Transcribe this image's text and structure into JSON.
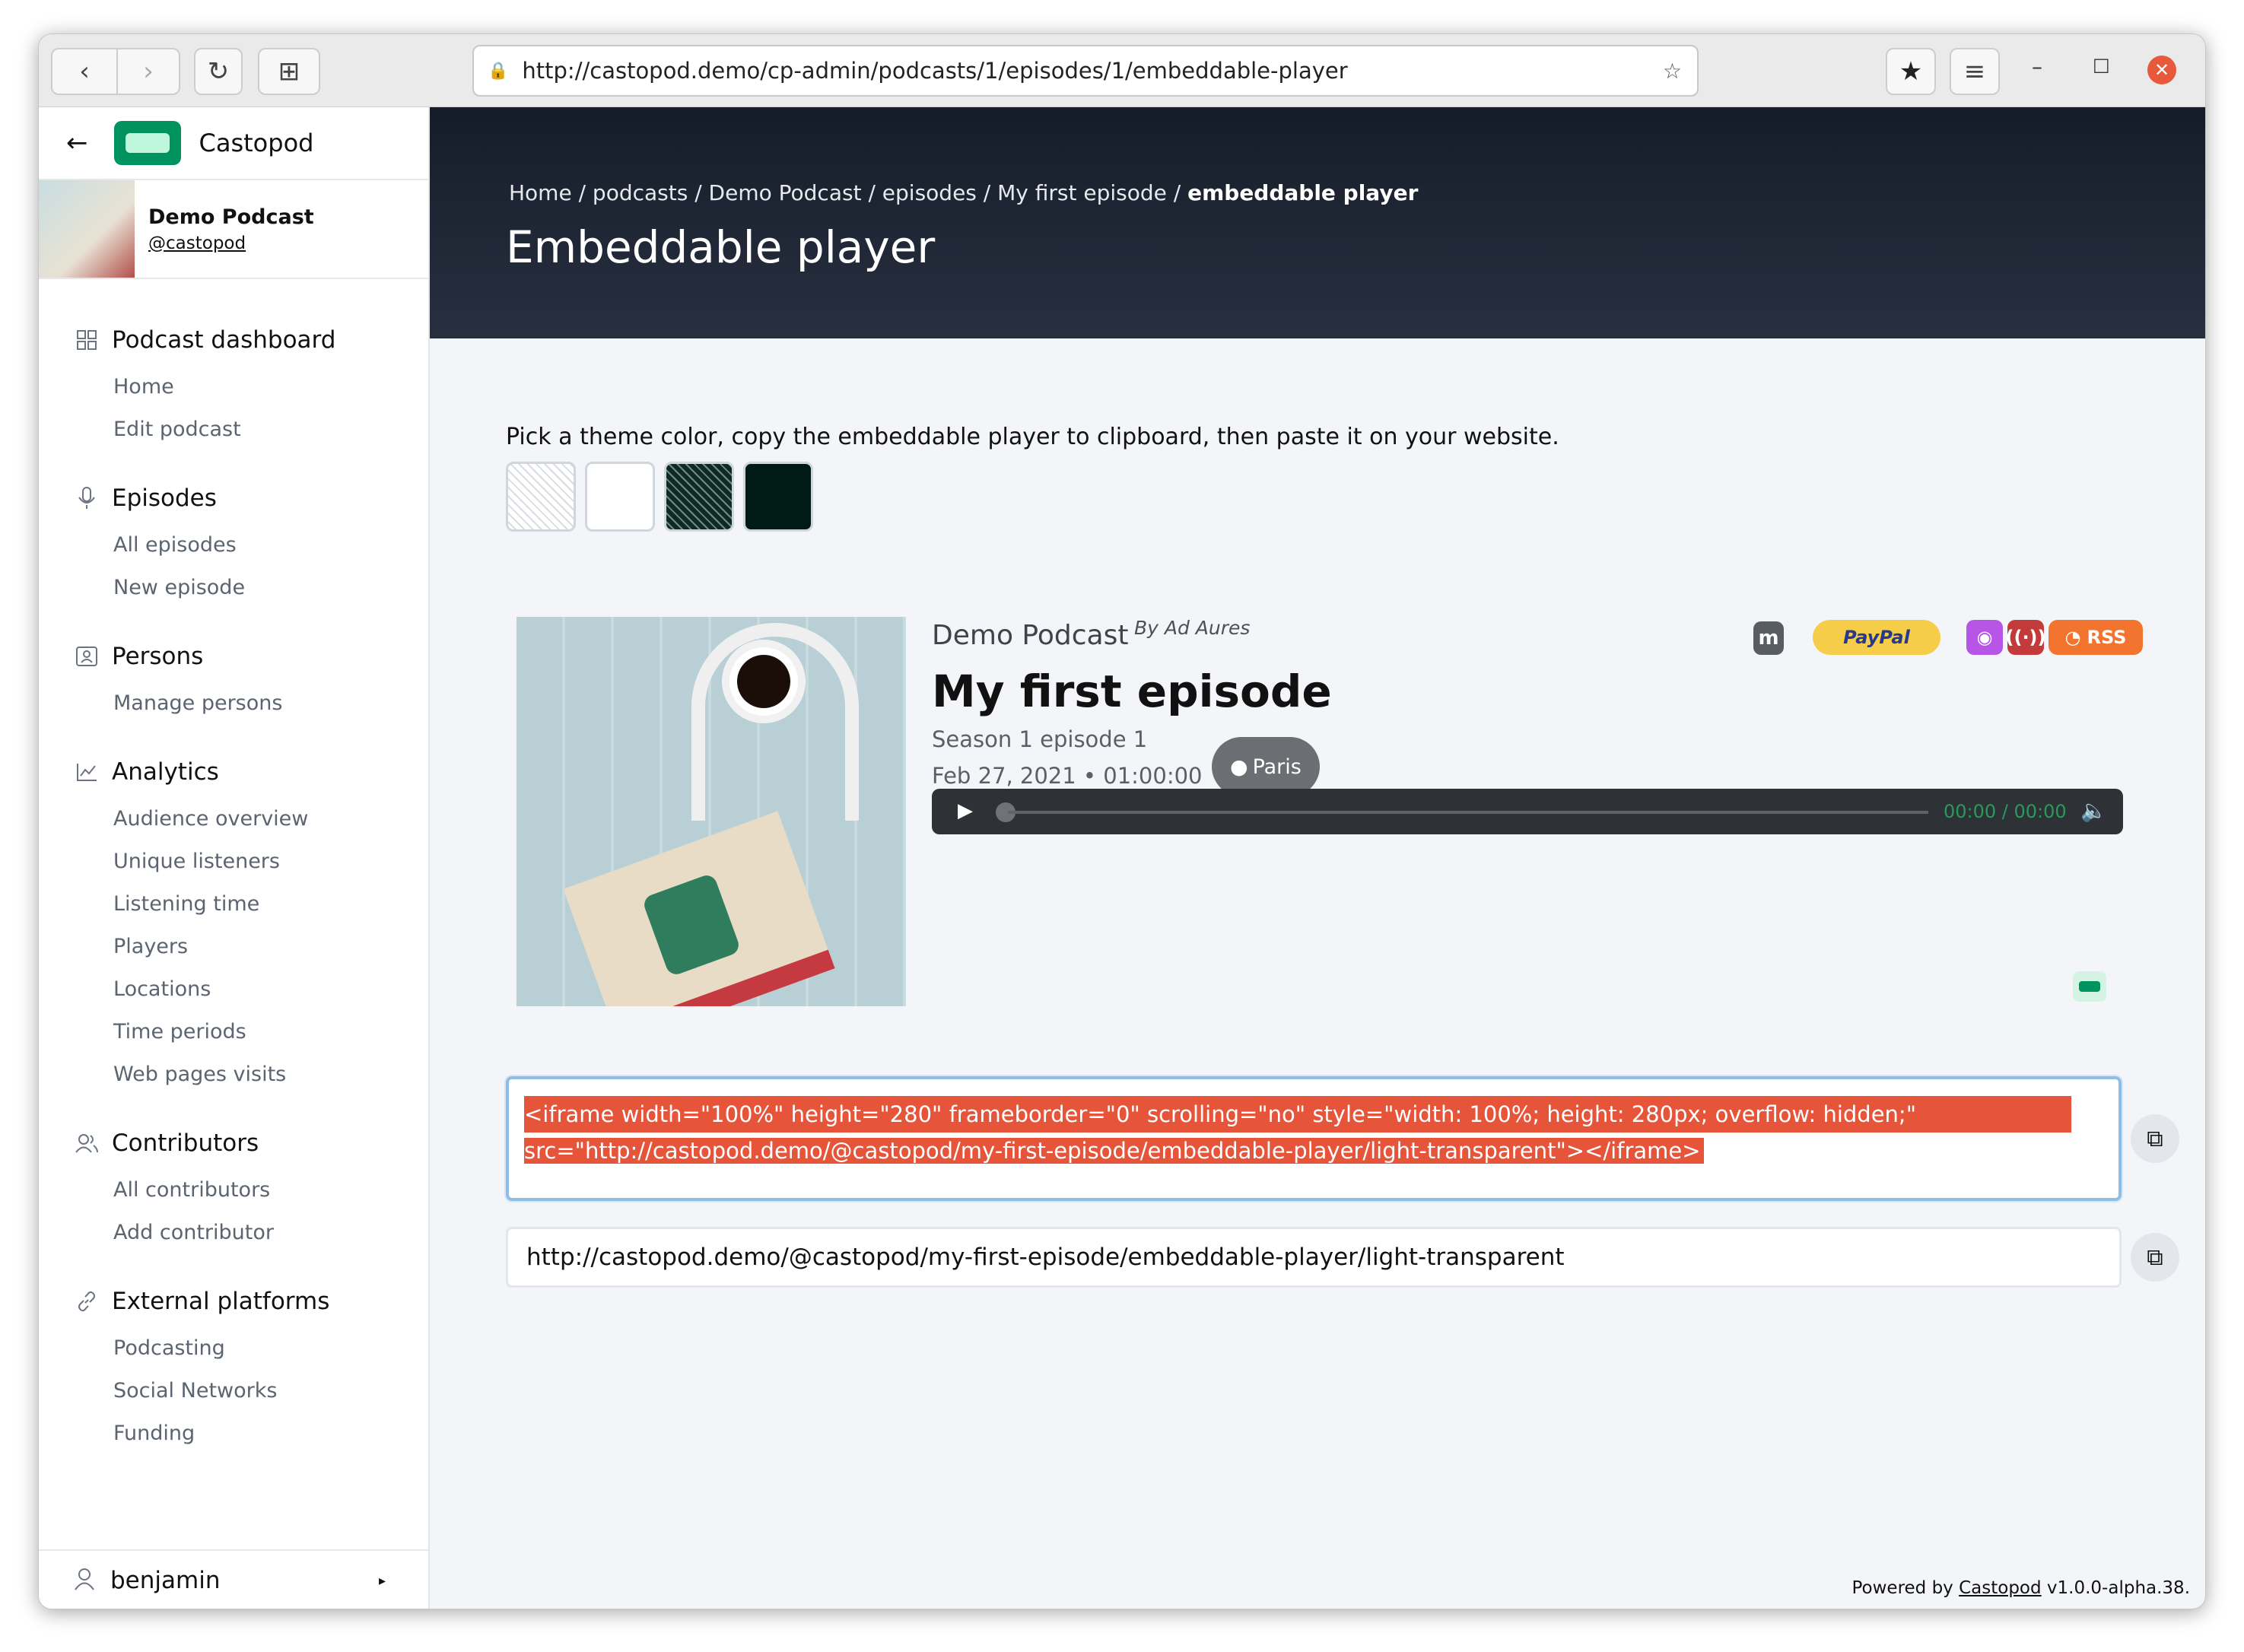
{
  "browser": {
    "url": "http://castopod.demo/cp-admin/podcasts/1/episodes/1/embeddable-player"
  },
  "sidebar": {
    "brand": "Castopod",
    "podcast_name": "Demo Podcast",
    "podcast_handle": "@castopod",
    "sections": [
      {
        "title": "Podcast dashboard",
        "items": [
          "Home",
          "Edit podcast"
        ]
      },
      {
        "title": "Episodes",
        "items": [
          "All episodes",
          "New episode"
        ]
      },
      {
        "title": "Persons",
        "items": [
          "Manage persons"
        ]
      },
      {
        "title": "Analytics",
        "items": [
          "Audience overview",
          "Unique listeners",
          "Listening time",
          "Players",
          "Locations",
          "Time periods",
          "Web pages visits"
        ]
      },
      {
        "title": "Contributors",
        "items": [
          "All contributors",
          "Add contributor"
        ]
      },
      {
        "title": "External platforms",
        "items": [
          "Podcasting",
          "Social Networks",
          "Funding"
        ]
      }
    ],
    "user": "benjamin"
  },
  "header": {
    "breadcrumb": [
      "Home",
      "podcasts",
      "Demo Podcast",
      "episodes",
      "My first episode"
    ],
    "breadcrumb_current": "embeddable player",
    "title": "Embeddable player"
  },
  "main": {
    "description": "Pick a theme color, copy the embeddable player to clipboard, then paste it on your website.",
    "theme_colors": [
      "#ffffff",
      "#ffffff",
      "#173b33",
      "#001a16"
    ],
    "preview": {
      "podcast": "Demo Podcast",
      "author": "By Ad Aures",
      "episode_title": "My first episode",
      "season_episode": "Season 1 episode 1",
      "date_duration": "Feb 27, 2021 • 01:00:00",
      "location": "Paris",
      "paypal": "PayPal",
      "rss": "RSS",
      "time": "00:00 / 00:00"
    },
    "iframe_code": "<iframe width=\"100%\" height=\"280\" frameborder=\"0\" scrolling=\"no\" style=\"width: 100%; height: 280px;  overflow: hidden;\" src=\"http://castopod.demo/@castopod/my-first-episode/embeddable-player/light-transparent\"></iframe>",
    "iframe_line1": "<iframe width=\"100%\" height=\"280\" frameborder=\"0\" scrolling=\"no\" style=\"width: 100%; height: 280px;  overflow: hidden;\"",
    "iframe_line2": "src=\"http://castopod.demo/@castopod/my-first-episode/embeddable-player/light-transparent\"></iframe>",
    "player_url": "http://castopod.demo/@castopod/my-first-episode/embeddable-player/light-transparent"
  },
  "footer": {
    "powered": "Powered by",
    "link": "Castopod",
    "version": "v1.0.0-alpha.38."
  }
}
